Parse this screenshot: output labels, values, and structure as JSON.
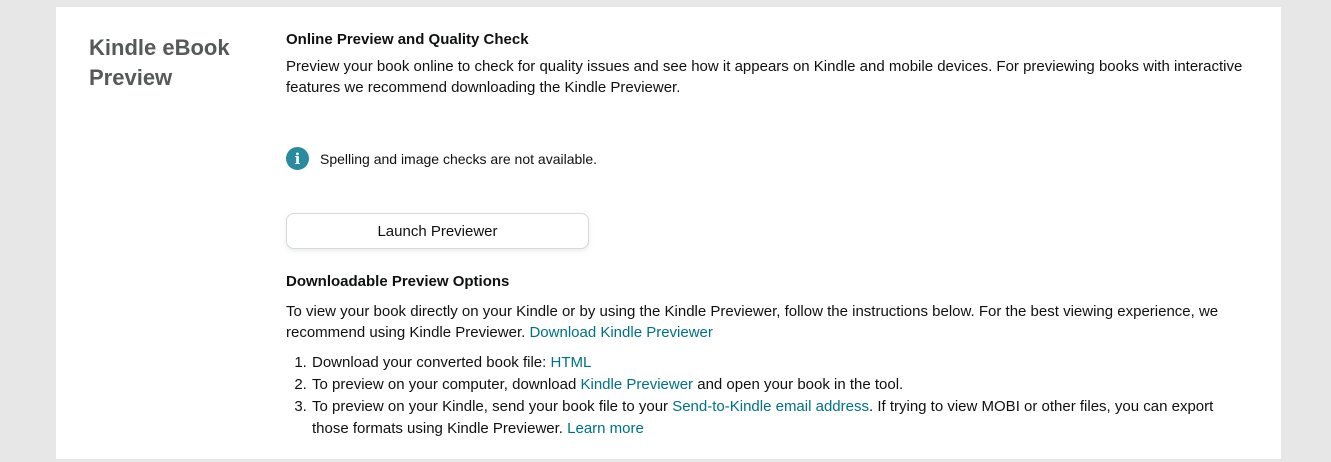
{
  "section": {
    "title": "Kindle eBook Preview"
  },
  "online": {
    "heading": "Online Preview and Quality Check",
    "description": "Preview your book online to check for quality issues and see how it appears on Kindle and mobile devices. For previewing books with interactive features we recommend downloading the Kindle Previewer.",
    "info_icon": "info-icon",
    "info_text": "Spelling and image checks are not available.",
    "launch_label": "Launch Previewer"
  },
  "downloadable": {
    "heading": "Downloadable Preview Options",
    "intro": "To view your book directly on your Kindle or by using the Kindle Previewer, follow the instructions below. For the best viewing experience, we recommend using Kindle Previewer.",
    "intro_link": "Download Kindle Previewer",
    "steps": [
      {
        "before": "Download your converted book file:",
        "link": "HTML",
        "after": ""
      },
      {
        "before": "To preview on your computer, download",
        "link": "Kindle Previewer",
        "after": "and open your book in the tool."
      },
      {
        "before": "To preview on your Kindle, send your book file to your",
        "link": "Send-to-Kindle email address",
        "after": ". If trying to view MOBI or other files, you can export those formats using Kindle Previewer.",
        "link2": "Learn more"
      }
    ]
  },
  "colors": {
    "link": "#007185",
    "info_icon_bg": "#2a8ba0",
    "section_title": "#565959",
    "page_bg": "#e7e7e7",
    "panel_bg": "#ffffff"
  }
}
